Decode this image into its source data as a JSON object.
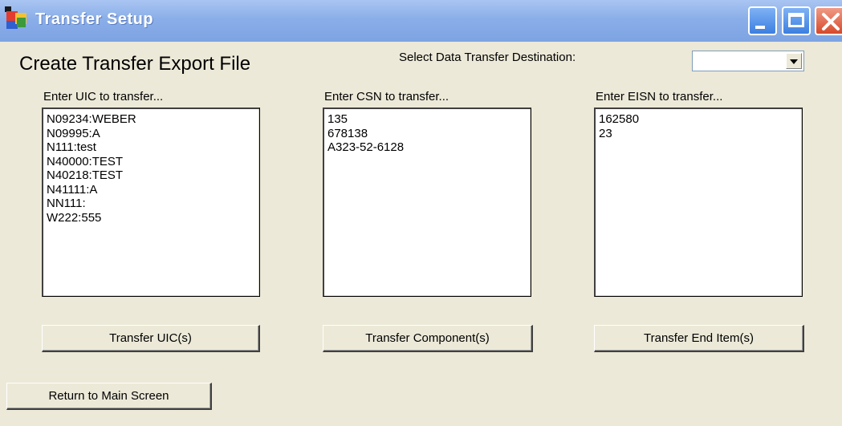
{
  "window": {
    "title": "Transfer Setup",
    "controls": {
      "minimize_icon": "minimize-icon",
      "maximize_icon": "maximize-icon",
      "close_icon": "close-icon"
    },
    "colors": {
      "titlebar": "#8aaee8",
      "close": "#d6492a",
      "body": "#ece9d8"
    }
  },
  "header": {
    "heading": "Create Transfer Export File",
    "destination_label": "Select Data Transfer Destination:",
    "destination_value": ""
  },
  "columns": [
    {
      "label": "Enter UIC to transfer...",
      "items": [
        "N09234:WEBER",
        "N09995:A",
        "N111:test",
        "N40000:TEST",
        "N40218:TEST",
        "N41111:A",
        "NN111:",
        "W222:555"
      ],
      "button": "Transfer UIC(s)"
    },
    {
      "label": "Enter CSN to transfer...",
      "items": [
        "135",
        "678138",
        "A323-52-6128"
      ],
      "button": "Transfer Component(s)"
    },
    {
      "label": "Enter EISN to transfer...",
      "items": [
        "162580",
        "23"
      ],
      "button": "Transfer End Item(s)"
    }
  ],
  "footer": {
    "return_button": "Return to Main Screen"
  }
}
